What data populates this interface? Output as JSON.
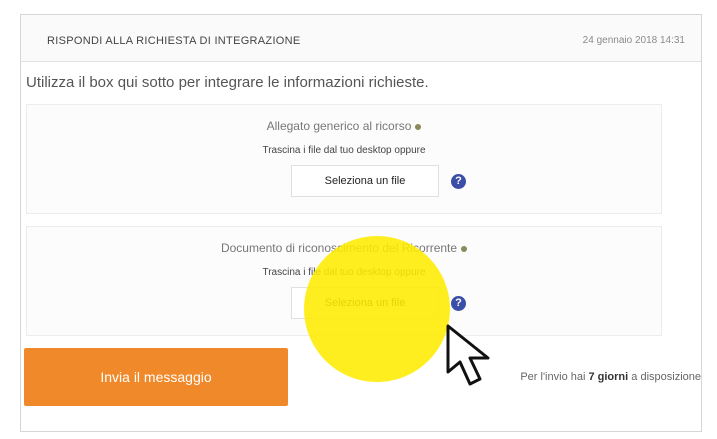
{
  "header": {
    "title": "RISPONDI ALLA RICHIESTA DI INTEGRAZIONE",
    "date": "24 gennaio 2018 14:31"
  },
  "intro": "Utilizza il box qui sotto per integrare le informazioni richieste.",
  "uploads": [
    {
      "label": "Allegato generico al ricorso",
      "drag_hint": "Trascina i file dal tuo desktop oppure",
      "button_label": "Seleziona un file",
      "help_icon": "?"
    },
    {
      "label": "Documento di riconoscimento del Ricorrente",
      "drag_hint": "Trascina i file dal tuo desktop oppure",
      "button_label": "Seleziona un file",
      "help_icon": "?"
    }
  ],
  "footer": {
    "send_label": "Invia il messaggio",
    "deadline_prefix": "Per l'invio hai",
    "deadline_value": "7 giorni",
    "deadline_suffix": "a disposizione"
  },
  "colors": {
    "accent": "#f0892a",
    "help_icon": "#3b4fa8",
    "highlight": "#ffec00"
  }
}
